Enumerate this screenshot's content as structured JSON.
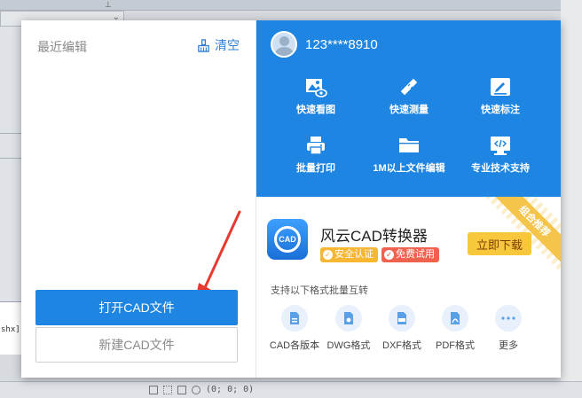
{
  "background": {
    "cmdline_text": "shx] ",
    "status_coords": "(0; 0; 0)"
  },
  "left_panel": {
    "title": "最近编辑",
    "clear_label": "清空",
    "open_button": "打开CAD文件",
    "new_button": "新建CAD文件"
  },
  "user": {
    "phone": "123****8910"
  },
  "tools": [
    {
      "label": "快速看图",
      "icon": "image-view-icon"
    },
    {
      "label": "快速测量",
      "icon": "ruler-pencil-icon"
    },
    {
      "label": "快速标注",
      "icon": "annotate-icon"
    },
    {
      "label": "批量打印",
      "icon": "printer-icon"
    },
    {
      "label": "1M以上文件编辑",
      "icon": "folder-icon"
    },
    {
      "label": "专业技术支持",
      "icon": "code-support-icon"
    }
  ],
  "promo": {
    "ribbon": "组合推荐",
    "logo_text": "CAD",
    "product_name": "风云CAD转换器",
    "badge_safe": "安全认证",
    "badge_free": "免费试用",
    "download_button": "立即下载",
    "formats_title": "支持以下格式批量互转",
    "formats": [
      {
        "label": "CAD各版本",
        "icon": "cad-file-icon"
      },
      {
        "label": "DWG格式",
        "icon": "dwg-file-icon"
      },
      {
        "label": "DXF格式",
        "icon": "dxf-file-icon"
      },
      {
        "label": "PDF格式",
        "icon": "pdf-file-icon"
      },
      {
        "label": "更多",
        "icon": "more-icon"
      }
    ]
  },
  "colors": {
    "primary_blue": "#1e86e2",
    "download_yellow": "#f8c83c",
    "badge_safe": "#f7b733",
    "badge_free": "#f0614e",
    "arrow_red": "#e8392f"
  }
}
